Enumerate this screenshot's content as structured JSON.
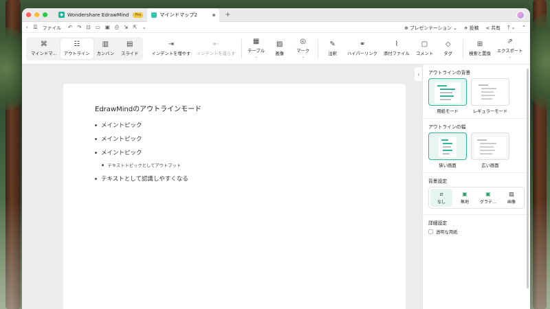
{
  "tabs": [
    {
      "label": "Wondershare EdrawMind",
      "badge": "Pro"
    },
    {
      "label": "マインドマップ2"
    }
  ],
  "menubar": {
    "file_label": "ファイル",
    "presentation_label": "プレゼンテーション",
    "post_label": "投稿",
    "share_label": "共有",
    "help_label": "?"
  },
  "ribbon": {
    "modes": [
      {
        "label": "マインドマ…",
        "icon": "mindmap-icon"
      },
      {
        "label": "アウトライン",
        "icon": "outline-icon",
        "selected": true
      },
      {
        "label": "カンバン",
        "icon": "kanban-icon"
      },
      {
        "label": "スライド",
        "icon": "slide-icon"
      }
    ],
    "tools": [
      {
        "label": "インデントを増やす",
        "icon": "indent-increase-icon"
      },
      {
        "label": "インデントを減らす",
        "icon": "indent-decrease-icon",
        "disabled": true
      },
      {
        "label": "テーブル",
        "icon": "table-icon",
        "caret": true
      },
      {
        "label": "画像",
        "icon": "image-icon"
      },
      {
        "label": "マーク",
        "icon": "mark-icon",
        "caret": true
      },
      {
        "label": "注釈",
        "icon": "annotation-icon"
      },
      {
        "label": "ハイパーリンク",
        "icon": "hyperlink-icon"
      },
      {
        "label": "添付ファイル",
        "icon": "attachment-icon"
      },
      {
        "label": "コメント",
        "icon": "comment-icon"
      },
      {
        "label": "タグ",
        "icon": "tag-icon"
      },
      {
        "label": "検索と置換",
        "icon": "find-replace-icon"
      },
      {
        "label": "エクスポート",
        "icon": "export-icon",
        "caret": true
      }
    ]
  },
  "outline": {
    "title": "EdrawMindのアウトラインモード",
    "items": [
      {
        "text": "メイントピック",
        "level": 1
      },
      {
        "text": "メイントピック",
        "level": 1
      },
      {
        "text": "メイントピック",
        "level": 1
      },
      {
        "text": "テキストトピックとしてアウトプット",
        "level": 2
      },
      {
        "text": "テキストとして認識しやすくなる",
        "level": 1
      }
    ]
  },
  "panel": {
    "background_heading": "アウトラインの背景",
    "background_options": [
      {
        "label": "用紙モード",
        "selected": true
      },
      {
        "label": "レギュラーモード",
        "selected": false
      }
    ],
    "width_heading": "アウトラインの幅",
    "width_options": [
      {
        "label": "狭い画面",
        "selected": true
      },
      {
        "label": "広い画面",
        "selected": false
      }
    ],
    "bg_setting_heading": "背景設定",
    "bg_setting_options": [
      {
        "label": "なし",
        "icon": "none-icon",
        "selected": true
      },
      {
        "label": "無地",
        "icon": "solid-fill-icon"
      },
      {
        "label": "グラデ…",
        "icon": "gradient-icon"
      },
      {
        "label": "画像",
        "icon": "image-icon"
      }
    ],
    "advanced_heading": "詳細設定",
    "transparent_paper_label": "透明な用紙"
  },
  "colors": {
    "accent": "#2bb89a",
    "pro_badge": "#f5c842",
    "canvas_bg": "#ececec"
  }
}
